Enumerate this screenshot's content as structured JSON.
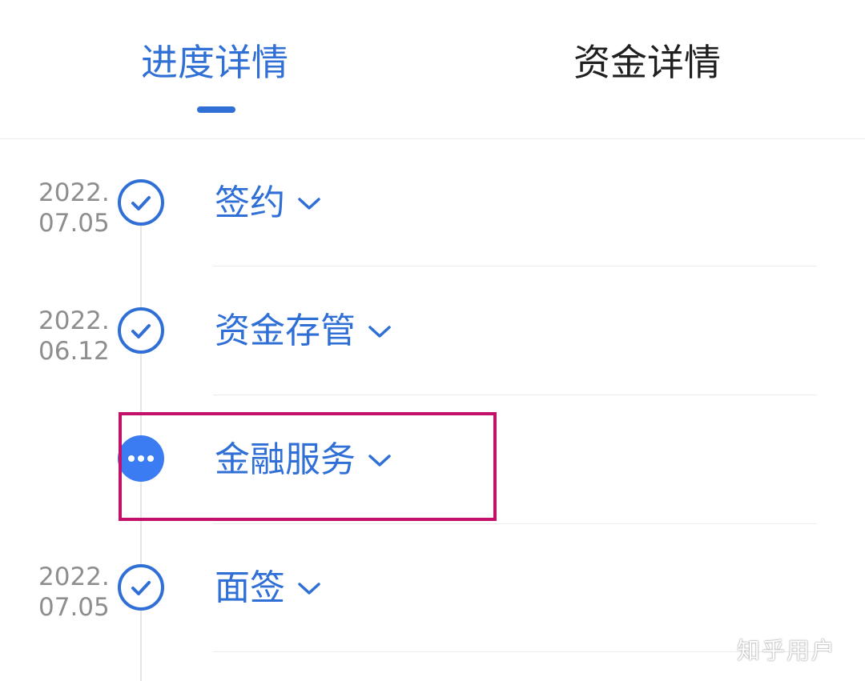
{
  "tabs": {
    "progress_label": "进度详情",
    "funds_label": "资金详情"
  },
  "timeline": [
    {
      "date_year": "2022.",
      "date_day": "07.05",
      "title": "签约",
      "status": "done"
    },
    {
      "date_year": "2022.",
      "date_day": "06.12",
      "title": "资金存管",
      "status": "done"
    },
    {
      "date_year": "",
      "date_day": "",
      "title": "金融服务",
      "status": "in-progress"
    },
    {
      "date_year": "2022.",
      "date_day": "07.05",
      "title": "面签",
      "status": "done"
    }
  ],
  "icons": {
    "done": "check-circle-icon",
    "in_progress": "more-dots-icon",
    "expand": "chevron-down-icon"
  },
  "colors": {
    "accent": "#2f6fd6",
    "pending_fill": "#3b7cf2",
    "highlight": "#c3116b",
    "date_text": "#8e8e8e"
  },
  "watermark": "知乎用户"
}
